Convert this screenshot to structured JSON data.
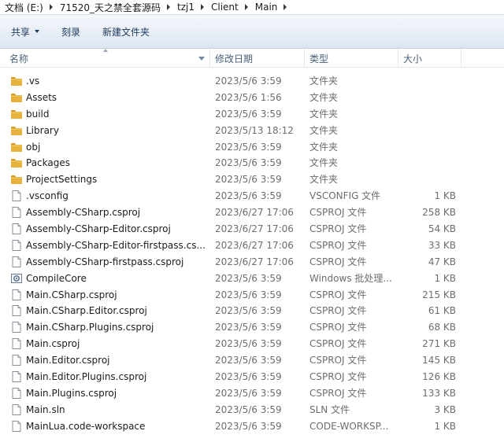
{
  "address": {
    "crumbs": [
      "文档 (E:)",
      "71520_天之禁全套源码",
      "tzj1",
      "Client",
      "Main"
    ]
  },
  "toolbar": {
    "share_label": "共享",
    "burn_label": "刻录",
    "new_folder_label": "新建文件夹"
  },
  "columns": {
    "name": "名称",
    "date": "修改日期",
    "type": "类型",
    "size": "大小"
  },
  "icons": {
    "folder": "folder-icon",
    "file": "file-icon",
    "batch": "batch-file-icon"
  },
  "colors": {
    "folder_body": "#e8b33c",
    "folder_tab": "#d39a1f",
    "toolbar_text": "#1e395b"
  },
  "files": [
    {
      "name": ".vs",
      "date": "2023/5/6 3:59",
      "type": "文件夹",
      "size": "",
      "icon": "folder"
    },
    {
      "name": "Assets",
      "date": "2023/5/6 1:56",
      "type": "文件夹",
      "size": "",
      "icon": "folder"
    },
    {
      "name": "build",
      "date": "2023/5/6 3:59",
      "type": "文件夹",
      "size": "",
      "icon": "folder"
    },
    {
      "name": "Library",
      "date": "2023/5/13 18:12",
      "type": "文件夹",
      "size": "",
      "icon": "folder"
    },
    {
      "name": "obj",
      "date": "2023/5/6 3:59",
      "type": "文件夹",
      "size": "",
      "icon": "folder"
    },
    {
      "name": "Packages",
      "date": "2023/5/6 3:59",
      "type": "文件夹",
      "size": "",
      "icon": "folder"
    },
    {
      "name": "ProjectSettings",
      "date": "2023/5/6 3:59",
      "type": "文件夹",
      "size": "",
      "icon": "folder"
    },
    {
      "name": ".vsconfig",
      "date": "2023/5/6 3:59",
      "type": "VSCONFIG 文件",
      "size": "1 KB",
      "icon": "file"
    },
    {
      "name": "Assembly-CSharp.csproj",
      "date": "2023/6/27 17:06",
      "type": "CSPROJ 文件",
      "size": "258 KB",
      "icon": "file"
    },
    {
      "name": "Assembly-CSharp-Editor.csproj",
      "date": "2023/6/27 17:06",
      "type": "CSPROJ 文件",
      "size": "54 KB",
      "icon": "file"
    },
    {
      "name": "Assembly-CSharp-Editor-firstpass.cs...",
      "date": "2023/6/27 17:06",
      "type": "CSPROJ 文件",
      "size": "33 KB",
      "icon": "file"
    },
    {
      "name": "Assembly-CSharp-firstpass.csproj",
      "date": "2023/6/27 17:06",
      "type": "CSPROJ 文件",
      "size": "47 KB",
      "icon": "file"
    },
    {
      "name": "CompileCore",
      "date": "2023/5/6 3:59",
      "type": "Windows 批处理...",
      "size": "1 KB",
      "icon": "batch"
    },
    {
      "name": "Main.CSharp.csproj",
      "date": "2023/5/6 3:59",
      "type": "CSPROJ 文件",
      "size": "215 KB",
      "icon": "file"
    },
    {
      "name": "Main.CSharp.Editor.csproj",
      "date": "2023/5/6 3:59",
      "type": "CSPROJ 文件",
      "size": "61 KB",
      "icon": "file"
    },
    {
      "name": "Main.CSharp.Plugins.csproj",
      "date": "2023/5/6 3:59",
      "type": "CSPROJ 文件",
      "size": "68 KB",
      "icon": "file"
    },
    {
      "name": "Main.csproj",
      "date": "2023/5/6 3:59",
      "type": "CSPROJ 文件",
      "size": "271 KB",
      "icon": "file"
    },
    {
      "name": "Main.Editor.csproj",
      "date": "2023/5/6 3:59",
      "type": "CSPROJ 文件",
      "size": "145 KB",
      "icon": "file"
    },
    {
      "name": "Main.Editor.Plugins.csproj",
      "date": "2023/5/6 3:59",
      "type": "CSPROJ 文件",
      "size": "126 KB",
      "icon": "file"
    },
    {
      "name": "Main.Plugins.csproj",
      "date": "2023/5/6 3:59",
      "type": "CSPROJ 文件",
      "size": "133 KB",
      "icon": "file"
    },
    {
      "name": "Main.sln",
      "date": "2023/5/6 3:59",
      "type": "SLN 文件",
      "size": "3 KB",
      "icon": "file"
    },
    {
      "name": "MainLua.code-workspace",
      "date": "2023/5/6 3:59",
      "type": "CODE-WORKSP...",
      "size": "1 KB",
      "icon": "file"
    }
  ]
}
